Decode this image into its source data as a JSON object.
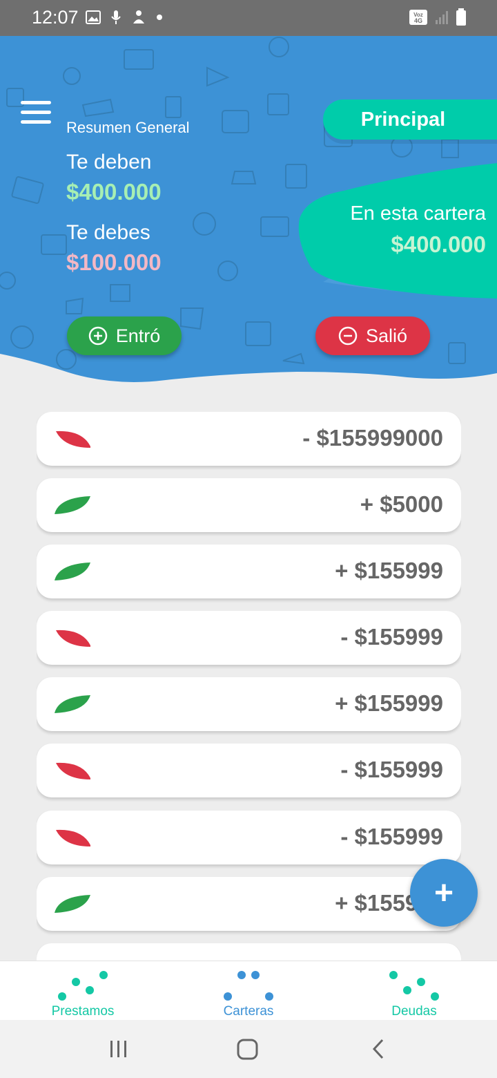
{
  "status_bar": {
    "time": "12:07",
    "network_badge": "Voz 4G",
    "icons": [
      "gallery-icon",
      "mic-icon",
      "assistant-icon",
      "dot-icon",
      "signal-icon",
      "battery-icon"
    ]
  },
  "header": {
    "background_color": "#3d92d6",
    "principal_label": "Principal",
    "summary_title": "Resumen General",
    "owed_to_you_label": "Te deben",
    "owed_to_you_amount": "$400.000",
    "you_owe_label": "Te debes",
    "you_owe_amount": "$100.000",
    "wallet_label": "En esta cartera",
    "wallet_amount": "$400.000",
    "income_button": "Entró",
    "expense_button": "Salió"
  },
  "colors": {
    "primary": "#3d92d6",
    "accent": "#00ccaa",
    "income": "#2ba24b",
    "expense": "#dd3446",
    "amount_text": "#666666"
  },
  "transactions": [
    {
      "type": "expense",
      "amount": "- $155999000"
    },
    {
      "type": "income",
      "amount": "+ $5000"
    },
    {
      "type": "income",
      "amount": "+ $155999"
    },
    {
      "type": "expense",
      "amount": "- $155999"
    },
    {
      "type": "income",
      "amount": "+ $155999"
    },
    {
      "type": "expense",
      "amount": "- $155999"
    },
    {
      "type": "expense",
      "amount": "- $155999"
    },
    {
      "type": "income",
      "amount": "+ $155999"
    },
    {
      "type": "income",
      "amount": ""
    }
  ],
  "fab_label": "+",
  "bottom_nav": {
    "items": [
      {
        "label": "Prestamos",
        "icon": "prestamos-dots-icon",
        "color": "#14c8a5"
      },
      {
        "label": "Carteras",
        "icon": "carteras-dots-icon",
        "color": "#3d92d6"
      },
      {
        "label": "Deudas",
        "icon": "deudas-dots-icon",
        "color": "#14c8a5"
      }
    ]
  },
  "system_nav": [
    "recents-icon",
    "home-icon",
    "back-icon"
  ]
}
